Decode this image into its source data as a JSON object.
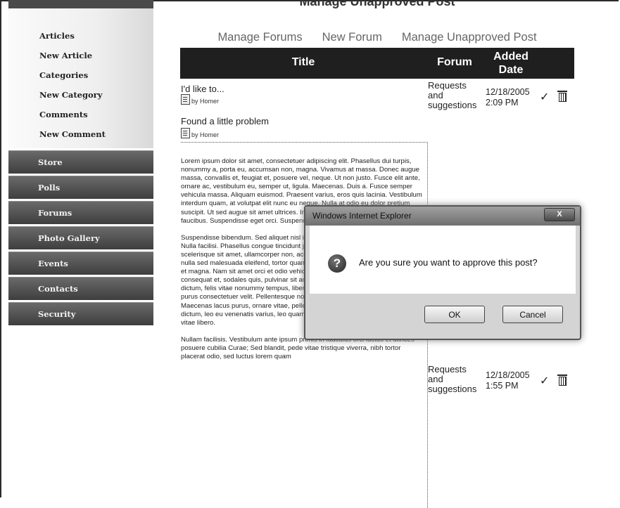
{
  "window_title": "Manage Unapproved Post",
  "sidebar": {
    "subitems": [
      "Articles",
      "New Article",
      "Categories",
      "New Category",
      "Comments",
      "New Comment"
    ],
    "nav": [
      "Store",
      "Polls",
      "Forums",
      "Photo Gallery",
      "Events",
      "Contacts",
      "Security"
    ]
  },
  "top_links": [
    "Manage Forums",
    "New Forum",
    "Manage Unapproved Post"
  ],
  "table": {
    "headers": {
      "title": "Title",
      "forum": "Forum",
      "added_line1": "Added",
      "added_line2": "Date"
    },
    "rows": [
      {
        "title": "I'd like to...",
        "by": "by Homer",
        "forum_line1": "Requests",
        "forum_line2": "and",
        "forum_line3": "suggestions",
        "date": "12/18/2005",
        "time": "2:09 PM"
      },
      {
        "title": "Found a little problem",
        "by": "by Homer",
        "forum_line1": "Requests",
        "forum_line2": "and",
        "forum_line3": "suggestions",
        "date": "12/18/2005",
        "time": "1:55 PM"
      }
    ]
  },
  "post_body": [
    "Lorem ipsum dolor sit amet, consectetuer adipiscing elit. Phasellus dui turpis, nonummy a, porta eu, accumsan non, magna. Vivamus at massa. Donec augue massa, convallis et, feugiat et, posuere vel, neque. Ut non justo. Fusce elit ante, ornare ac, vestibulum eu, semper ut, ligula. Maecenas. Duis a. Fusce semper vehicula massa. Aliquam euismod. Praesent varius, eros quis lacinia. Vestibulum interdum quam, at volutpat elit nunc eu neque. Nulla at odio eu dolor pretium suscipit. Ut sed augue sit amet ultrices. In dui ante, mattis sed, at aliquet ac, faucibus. Suspendisse eget orci. Suspendisse at mattis.",
    "Suspendisse bibendum. Sed aliquet nisl ipsum consequat metus, sit amet lacinia. Nulla facilisi. Phasellus congue tincidunt justo euismod tristique. Mauris gravida scelerisque sit amet, ullamcorper non, accumsan et, urna. Vivamus faucibus, nulla sed malesuada eleifend, tortor quam lobortis lectus, at bibendum velit risus et magna. Nam sit amet orci et odio vehicula tempor. Maecenas ipsum diam, consequat et, sodales quis, pulvinar sit amet, nisi. Maecenas a mauris. Etiam dictum, felis vitae nonummy tempus, libero libero pellentesque felis, a lacinia nisl purus consectetuer velit. Pellentesque non arcu. Nullam aliquet metus quis tellus. Maecenas lacus purus, ornare vitae, pellentesque et, adipiscing vel, metus. Sed dictum, leo eu venenatis varius, leo quam pellentesque mi, eu luctus libero ante vitae libero.",
    "Nullam facilisis. Vestibulum ante ipsum primis in faucibus orci luctus et ultrices posuere cubilia Curae; Sed blandit, pede vitae tristique viverra, nibh tortor placerat odio, sed luctus lorem quam"
  ],
  "dialog": {
    "title": "Windows Internet Explorer",
    "close": "X",
    "message": "Are you sure you want to approve this post?",
    "ok": "OK",
    "cancel": "Cancel"
  },
  "icons": {
    "approve": "check-icon",
    "delete": "trash-icon",
    "post": "document-icon",
    "question": "question-icon"
  }
}
